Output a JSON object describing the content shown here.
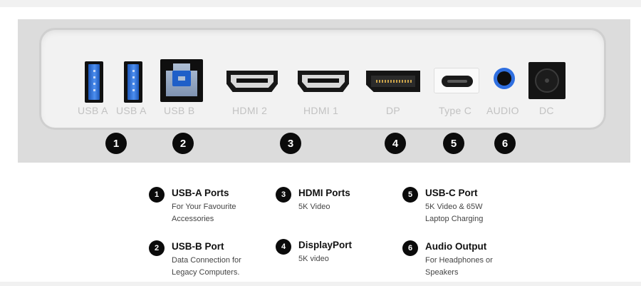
{
  "ports": [
    {
      "label": "USB A"
    },
    {
      "label": "USB A"
    },
    {
      "label": "USB B"
    },
    {
      "label": "HDMI 2"
    },
    {
      "label": "HDMI 1"
    },
    {
      "label": "DP"
    },
    {
      "label": "Type C"
    },
    {
      "label": "AUDIO"
    },
    {
      "label": "DC"
    }
  ],
  "badges": [
    "1",
    "2",
    "3",
    "4",
    "5",
    "6"
  ],
  "legend": [
    {
      "num": "1",
      "title": "USB-A Ports",
      "desc": [
        "For Your Favourite",
        "Accessories"
      ]
    },
    {
      "num": "2",
      "title": "USB-B Port",
      "desc": [
        "Data Connection for",
        "Legacy Computers."
      ]
    },
    {
      "num": "3",
      "title": "HDMI Ports",
      "desc": [
        "5K Video"
      ]
    },
    {
      "num": "4",
      "title": "DisplayPort",
      "desc": [
        "5K video"
      ]
    },
    {
      "num": "5",
      "title": "USB-C Port",
      "desc": [
        "5K Video & 65W",
        "Laptop Charging"
      ]
    },
    {
      "num": "6",
      "title": "Audio Output",
      "desc": [
        "For Headphones or",
        "Speakers"
      ]
    }
  ],
  "colors": {
    "usb_blue": "#2f6fe0",
    "badge": "#0b0b0b",
    "panel": "#dcdcdc",
    "port_label": "#c2c2c2"
  }
}
